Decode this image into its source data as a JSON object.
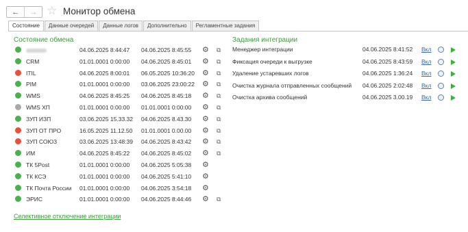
{
  "header": {
    "title": "Монитор обмена"
  },
  "tabs": [
    {
      "label": "Состояние",
      "active": true
    },
    {
      "label": "Данные очередей",
      "active": false
    },
    {
      "label": "Данные логов",
      "active": false
    },
    {
      "label": "Дополнительно",
      "active": false
    },
    {
      "label": "Регламентные задания",
      "active": false
    }
  ],
  "status": {
    "title": "Состояние обмена",
    "rows": [
      {
        "name": "",
        "blurred": true,
        "color": "#4caf50",
        "d1": "04.06.2025 8:44:47",
        "d2": "04.06.2025 8:45:55",
        "extra": "link-icon"
      },
      {
        "name": "CRM",
        "color": "#4caf50",
        "d1": "01.01.0001 0:00:00",
        "d2": "04.06.2025 8:45:01",
        "extra": "link-icon"
      },
      {
        "name": "ITIL",
        "color": "#e8503a",
        "d1": "04.06.2025 8:00:01",
        "d2": "06.05.2025 10:36:20",
        "extra": "link-icon"
      },
      {
        "name": "PIM",
        "color": "#4caf50",
        "d1": "01.01.0001 0:00:00",
        "d2": "03.06.2025 23:00:22",
        "extra": "link-icon"
      },
      {
        "name": "WMS",
        "color": "#4caf50",
        "d1": "04.06.2025 8:45:25",
        "d2": "04.06.2025 8:45:18",
        "extra": "link-icon"
      },
      {
        "name": "WMS ХП",
        "color": "#a9a9a9",
        "d1": "01.01.0001 0:00:00",
        "d2": "01.01.0001 0:00:00",
        "extra": "link-icon"
      },
      {
        "name": "ЗУП ИЗП",
        "color": "#4caf50",
        "d1": "03.06.2025 15.33.32",
        "d2": "04.06.2025 8.43.30",
        "extra": "link-icon"
      },
      {
        "name": "ЗУП ОТ ПРО",
        "color": "#e8503a",
        "d1": "16.05.2025 11.12.50",
        "d2": "01.01.0001 0.00.00",
        "extra": "link-icon"
      },
      {
        "name": "ЗУП СОЮЗ",
        "color": "#e8503a",
        "d1": "03.06.2025 13:48:39",
        "d2": "04.06.2025 8:43:42",
        "extra": "link-icon"
      },
      {
        "name": "ИМ",
        "color": "#4caf50",
        "d1": "04.06.2025 8:45:22",
        "d2": "04.06.2025 8:45:02",
        "extra": "link-icon"
      },
      {
        "name": "ТК 5Post",
        "color": "#4caf50",
        "d1": "01.01.0001 0:00:00",
        "d2": "04.06.2025 5:05:38",
        "extra": ""
      },
      {
        "name": "ТК КСЭ",
        "color": "#4caf50",
        "d1": "01.01.0001 0:00:00",
        "d2": "04.06.2025 5:41:10",
        "extra": ""
      },
      {
        "name": "ТК Почта России",
        "color": "#4caf50",
        "d1": "01.01.0001 0:00:00",
        "d2": "04.06.2025 3:54:18",
        "extra": ""
      },
      {
        "name": "ЭРИС",
        "color": "#4caf50",
        "d1": "01.01.0001 0:00:00",
        "d2": "04.06.2025 8:44:46",
        "extra": "link-icon"
      }
    ],
    "selective_link": "Селективное отключение интеграции"
  },
  "tasks": {
    "title": "Задания интеграции",
    "rows": [
      {
        "name": "Менеджер интеграции",
        "dt": "04.06.2025 8:41:52",
        "toggle": "Вкл"
      },
      {
        "name": "Фиксация очереди к выгрузке",
        "dt": "04.06.2025 8:43:59",
        "toggle": "Вкл"
      },
      {
        "name": "Удаление устаревших логов",
        "dt": "04.06.2025 1:36:24",
        "toggle": "Вкл"
      },
      {
        "name": "Очистка журнала отправленных сообщений",
        "dt": "04.06.2025 2:02:48",
        "toggle": "Вкл"
      },
      {
        "name": "Очистка архива сообщений",
        "dt": "04.06.2025 3.00.19",
        "toggle": "Вкл"
      }
    ]
  }
}
